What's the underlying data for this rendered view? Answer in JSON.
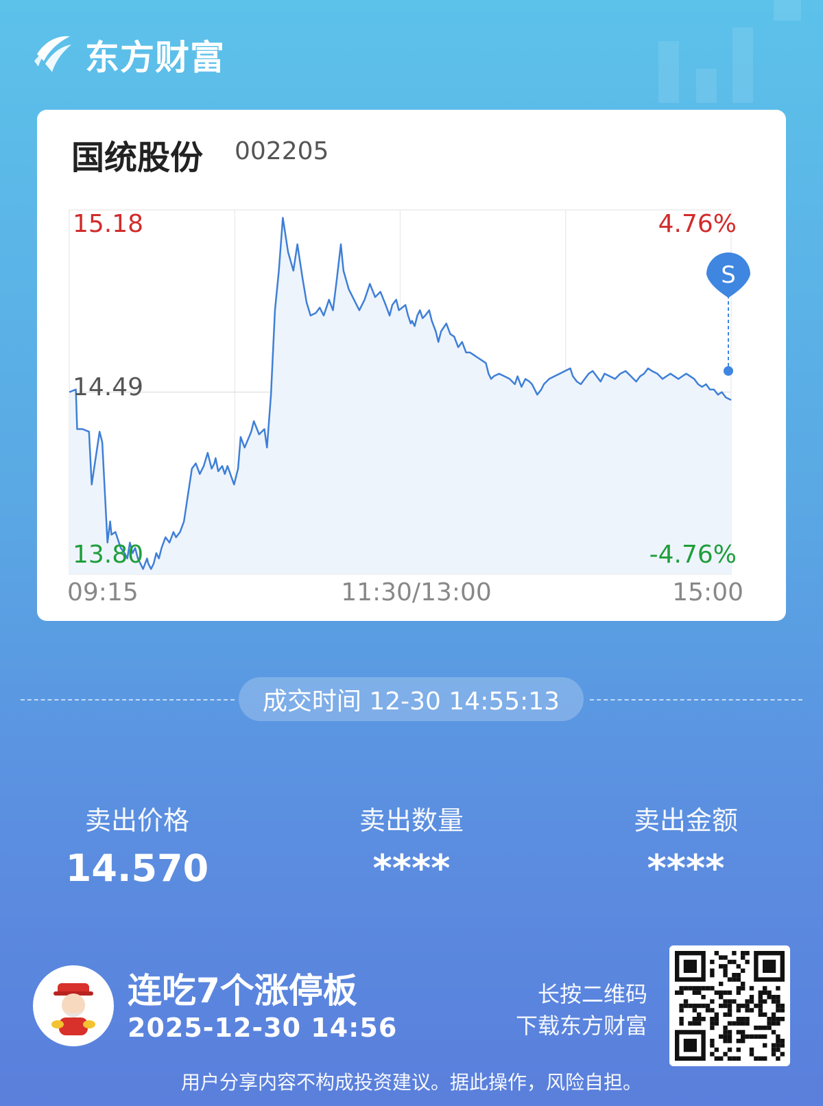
{
  "brand": {
    "name": "东方财富"
  },
  "stock": {
    "name": "国统股份",
    "code": "002205"
  },
  "chart_data": {
    "type": "line",
    "title": "",
    "price_high_label": "15.18",
    "price_mid_label": "14.49",
    "price_low_label": "13.80",
    "pct_high_label": "4.76%",
    "pct_low_label": "-4.76%",
    "time_labels": [
      "09:15",
      "11:30/13:00",
      "15:00"
    ],
    "ylim": [
      13.8,
      15.18
    ],
    "prev_close": 14.49,
    "grid": true,
    "colors": {
      "line": "#3e7fd6",
      "fill": "#eef4fc",
      "up": "#d22b2b",
      "down": "#1f9e3a",
      "marker": "#3e86e0"
    },
    "marker": {
      "label": "S",
      "price": 14.57
    },
    "x": [
      0.0,
      0.5,
      0.6,
      1.0,
      1.5,
      1.7,
      2.3,
      2.5,
      2.9,
      3.1,
      3.2,
      3.5,
      3.9,
      4.2,
      4.4,
      4.6,
      4.8,
      5.0,
      5.2,
      5.4,
      5.6,
      5.9,
      6.0,
      6.2,
      6.4,
      6.6,
      6.8,
      7.0,
      7.3,
      7.6,
      7.9,
      8.1,
      8.4,
      8.7,
      9.0,
      9.3,
      9.6,
      9.9,
      10.2,
      10.5,
      10.8,
      11.0,
      11.1,
      11.3,
      11.6,
      11.8,
      12.0,
      12.5,
      12.8,
      13.0,
      13.3,
      13.8,
      14.0,
      14.4,
      14.8,
      15.0,
      15.3,
      15.6,
      15.9,
      16.2,
      16.6,
      17.0,
      17.3,
      17.7,
      18.0,
      18.3,
      18.7,
      19.0,
      19.3,
      19.7,
      20.0,
      20.3,
      20.6,
      20.8,
      21.2,
      21.6,
      22.0,
      22.4,
      22.8,
      23.2,
      23.6,
      24.0,
      24.3,
      24.5,
      24.8,
      25.0,
      25.5,
      25.7,
      25.9,
      26.0,
      26.2,
      26.4,
      26.6,
      26.8,
      27.0,
      27.3,
      27.5,
      27.8,
      28.0,
      28.2,
      28.6,
      28.9,
      29.2,
      29.5,
      29.8,
      30.1,
      30.4,
      30.7,
      31.0,
      31.3,
      31.6,
      31.8,
      32.0,
      32.2,
      32.6,
      33.0,
      33.4,
      33.8,
      34.0,
      34.3,
      34.6,
      34.9,
      35.1,
      35.3,
      35.5,
      35.8,
      36.0,
      36.4,
      36.8,
      37.2,
      37.6,
      38.0,
      38.2,
      38.5,
      38.8,
      39.1,
      39.4,
      39.7,
      40.0,
      40.3,
      40.6,
      41.0,
      41.4,
      41.8,
      42.2,
      42.6,
      43.0,
      43.3,
      43.6,
      43.9,
      44.2,
      44.6,
      45.0,
      45.3,
      45.6,
      45.9,
      46.2,
      46.5,
      46.8,
      47.1,
      47.4,
      47.7,
      48.0,
      48.3,
      48.6,
      48.9,
      49.2,
      49.5,
      49.8,
      50.2
    ],
    "y": [
      14.49,
      14.5,
      14.35,
      14.35,
      14.34,
      14.14,
      14.34,
      14.3,
      13.92,
      14.0,
      13.95,
      13.96,
      13.9,
      13.88,
      13.86,
      13.92,
      13.88,
      13.9,
      13.86,
      13.84,
      13.82,
      13.86,
      13.84,
      13.82,
      13.84,
      13.88,
      13.86,
      13.9,
      13.94,
      13.92,
      13.96,
      13.94,
      13.96,
      14.0,
      14.1,
      14.2,
      14.22,
      14.18,
      14.21,
      14.26,
      14.2,
      14.22,
      14.24,
      14.19,
      14.21,
      14.18,
      14.21,
      14.14,
      14.2,
      14.32,
      14.28,
      14.34,
      14.38,
      14.33,
      14.35,
      14.28,
      14.48,
      14.8,
      14.95,
      15.15,
      15.02,
      14.95,
      15.05,
      14.92,
      14.83,
      14.78,
      14.79,
      14.81,
      14.78,
      14.84,
      14.8,
      14.92,
      15.05,
      14.95,
      14.88,
      14.84,
      14.8,
      14.84,
      14.9,
      14.85,
      14.87,
      14.82,
      14.78,
      14.82,
      14.84,
      14.8,
      14.82,
      14.78,
      14.75,
      14.76,
      14.74,
      14.78,
      14.8,
      14.77,
      14.78,
      14.8,
      14.76,
      14.72,
      14.68,
      14.72,
      14.75,
      14.71,
      14.7,
      14.66,
      14.68,
      14.64,
      14.64,
      14.63,
      14.62,
      14.61,
      14.6,
      14.56,
      14.54,
      14.55,
      14.56,
      14.55,
      14.54,
      14.52,
      14.55,
      14.51,
      14.54,
      14.53,
      14.52,
      14.5,
      14.48,
      14.5,
      14.52,
      14.54,
      14.55,
      14.56,
      14.57,
      14.58,
      14.55,
      14.53,
      14.52,
      14.54,
      14.56,
      14.57,
      14.55,
      14.53,
      14.56,
      14.55,
      14.54,
      14.56,
      14.57,
      14.55,
      14.53,
      14.55,
      14.56,
      14.58,
      14.57,
      14.56,
      14.54,
      14.55,
      14.56,
      14.55,
      14.54,
      14.55,
      14.56,
      14.55,
      14.54,
      14.52,
      14.51,
      14.52,
      14.5,
      14.5,
      14.48,
      14.49,
      14.47,
      14.46,
      14.5,
      14.52,
      14.57,
      14.56
    ]
  },
  "trade": {
    "time_label": "成交时间 12-30 14:55:13"
  },
  "stats": [
    {
      "label": "卖出价格",
      "value": "14.570"
    },
    {
      "label": "卖出数量",
      "value": "****"
    },
    {
      "label": "卖出金额",
      "value": "****"
    }
  ],
  "promo": {
    "title": "连吃7个涨停板",
    "date": "2025-12-30 14:56"
  },
  "qr": {
    "hint1": "长按二维码",
    "hint2": "下载东方财富"
  },
  "footer": {
    "disclaimer": "用户分享内容不构成投资建议。据此操作，风险自担。"
  }
}
